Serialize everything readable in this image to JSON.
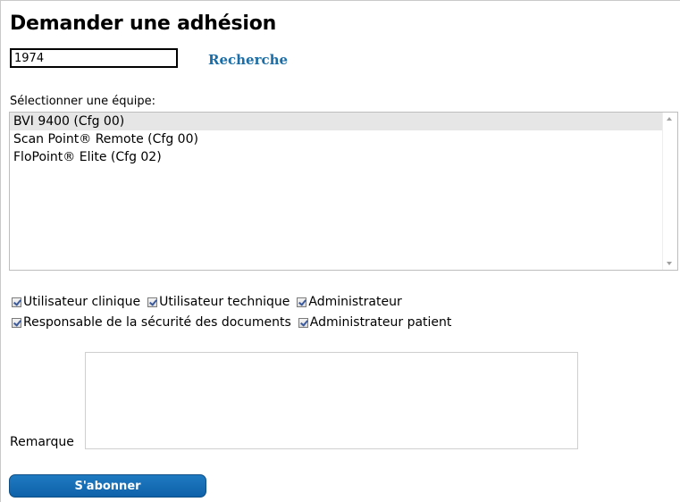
{
  "page": {
    "title": "Demander une adhésion"
  },
  "search": {
    "value": "1974",
    "link_label": "Recherche"
  },
  "team_select": {
    "label": "Sélectionner une équipe:",
    "items": [
      {
        "label": "BVI 9400 (Cfg 00)",
        "selected": true
      },
      {
        "label": "Scan Point® Remote (Cfg 00)",
        "selected": false
      },
      {
        "label": "FloPoint® Elite (Cfg 02)",
        "selected": false
      }
    ]
  },
  "roles": {
    "row1": [
      {
        "label": "Utilisateur clinique",
        "checked": true
      },
      {
        "label": "Utilisateur technique",
        "checked": true
      },
      {
        "label": "Administrateur",
        "checked": true
      }
    ],
    "row2": [
      {
        "label": "Responsable de la sécurité des documents",
        "checked": true
      },
      {
        "label": "Administrateur patient",
        "checked": true
      }
    ]
  },
  "remark": {
    "label": "Remarque",
    "value": ""
  },
  "submit": {
    "label": "S'abonner"
  },
  "colors": {
    "link": "#1b6ea7",
    "button": "#1e7ac2",
    "selected_row": "#e6e6e6"
  }
}
